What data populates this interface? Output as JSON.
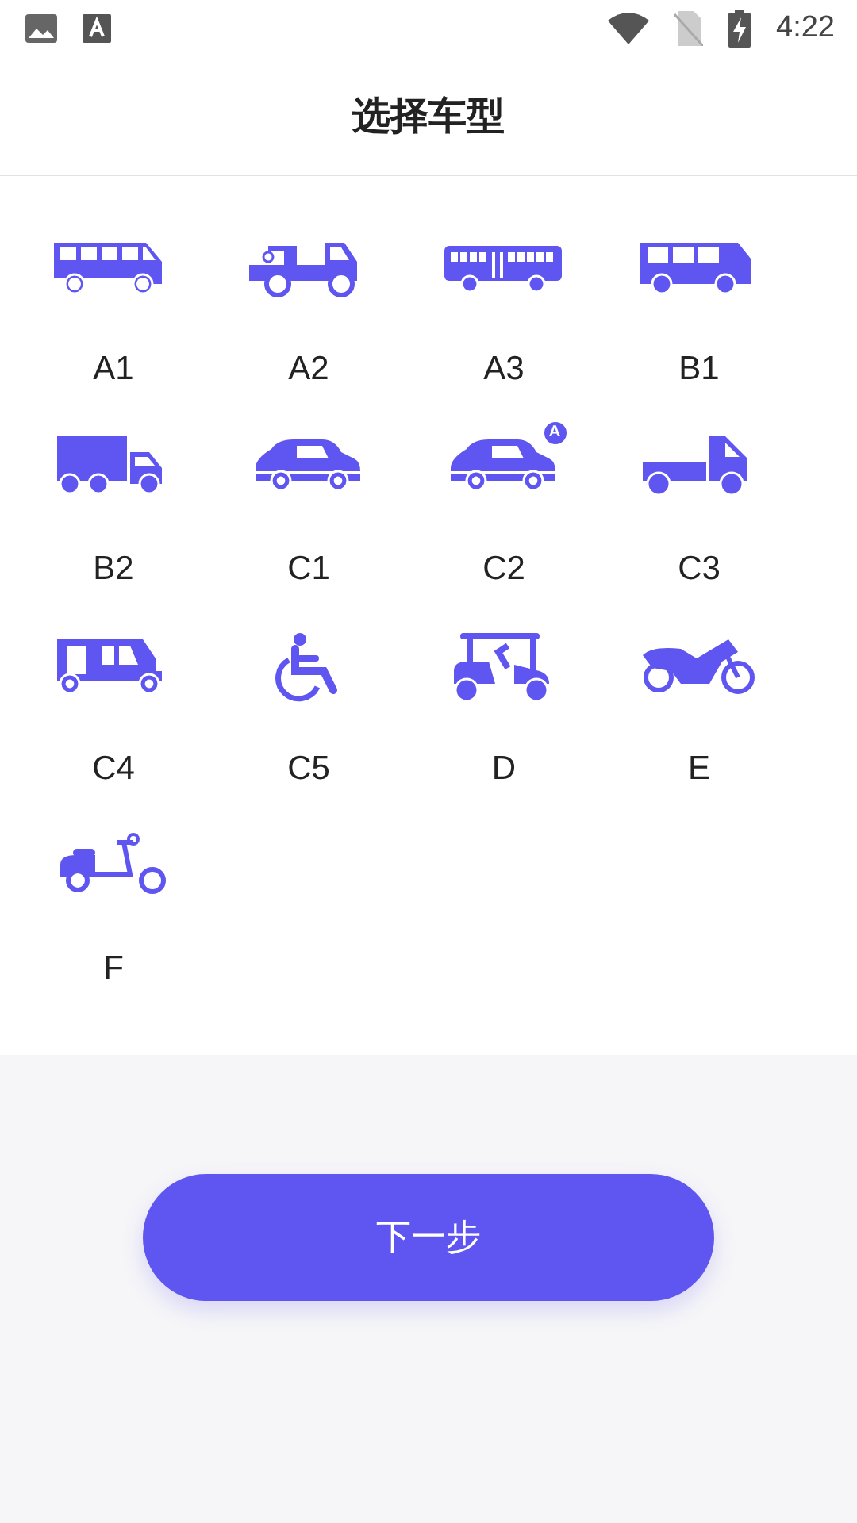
{
  "status_bar": {
    "time": "4:22"
  },
  "header": {
    "title": "选择车型"
  },
  "vehicle_types": [
    {
      "label": "A1",
      "kind": "bus"
    },
    {
      "label": "A2",
      "kind": "tow-truck"
    },
    {
      "label": "A3",
      "kind": "city-bus"
    },
    {
      "label": "B1",
      "kind": "minibus"
    },
    {
      "label": "B2",
      "kind": "box-truck"
    },
    {
      "label": "C1",
      "kind": "car"
    },
    {
      "label": "C2",
      "kind": "car",
      "badge": "A"
    },
    {
      "label": "C3",
      "kind": "pickup"
    },
    {
      "label": "C4",
      "kind": "tuk-tuk"
    },
    {
      "label": "C5",
      "kind": "wheelchair"
    },
    {
      "label": "D",
      "kind": "golf-cart"
    },
    {
      "label": "E",
      "kind": "motorcycle"
    },
    {
      "label": "F",
      "kind": "scooter"
    }
  ],
  "next_button": {
    "label": "下一步"
  }
}
